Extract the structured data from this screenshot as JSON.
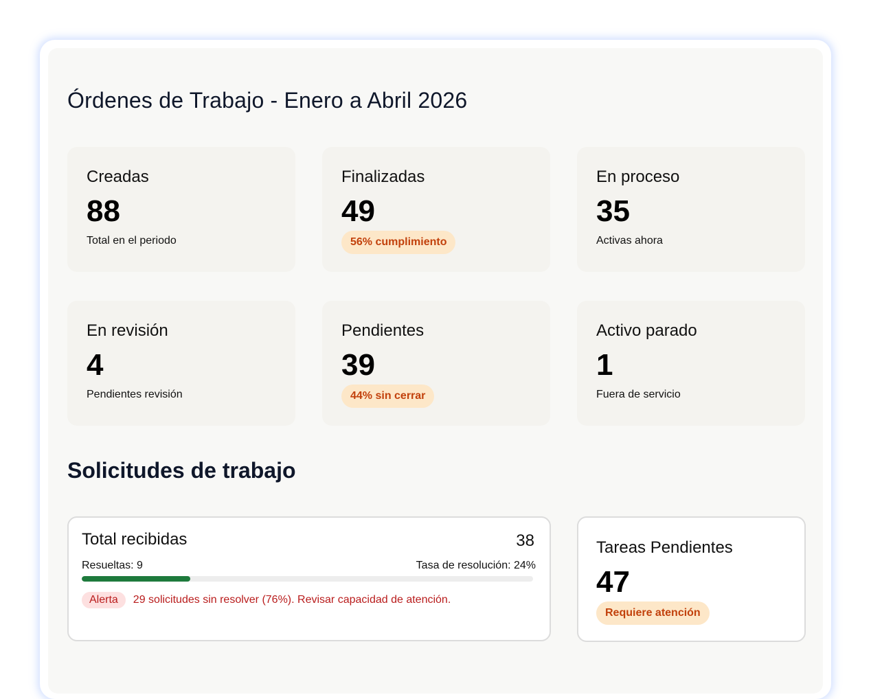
{
  "title": "Órdenes de Trabajo - Enero a Abril 2026",
  "cards": [
    {
      "label": "Creadas",
      "value": "88",
      "sub": "Total en el periodo"
    },
    {
      "label": "Finalizadas",
      "value": "49",
      "pill": "56% cumplimiento"
    },
    {
      "label": "En proceso",
      "value": "35",
      "sub": "Activas ahora"
    },
    {
      "label": "En revisión",
      "value": "4",
      "sub": "Pendientes revisión"
    },
    {
      "label": "Pendientes",
      "value": "39",
      "pill": "44% sin cerrar"
    },
    {
      "label": "Activo parado",
      "value": "1",
      "sub": "Fuera de servicio"
    }
  ],
  "requests": {
    "section_title": "Solicitudes de trabajo",
    "title": "Total recibidas",
    "total": "38",
    "resolved": "Resueltas: 9",
    "rate": "Tasa de resolución: 24%",
    "progress_fraction": 0.24,
    "alert_badge": "Alerta",
    "alert_text": "29 solicitudes sin resolver (76%). Revisar capacidad de atención."
  },
  "tasks": {
    "label": "Tareas Pendientes",
    "value": "47",
    "pill": "Requiere atención"
  },
  "colors": {
    "pill_bg": "#fde7c8",
    "pill_text": "#c2410c",
    "progress": "#1e7a3c",
    "alert": "#b91c1c"
  }
}
